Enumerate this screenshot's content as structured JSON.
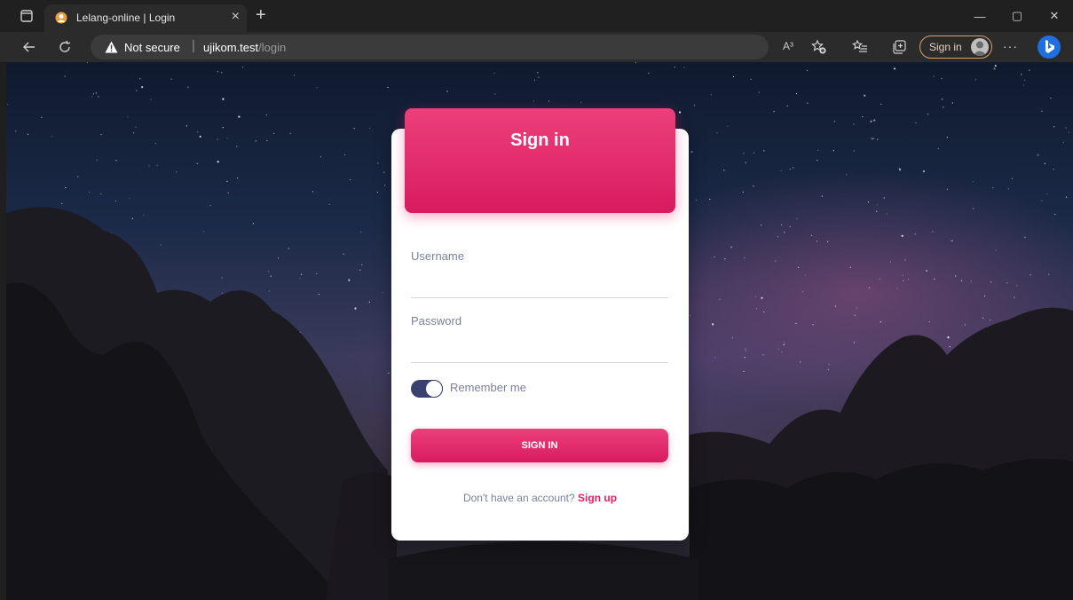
{
  "browser": {
    "tab_title": "Lelang-online | Login",
    "tab_close": "×",
    "new_tab": "+",
    "security_label": "Not secure",
    "address_separator": "|",
    "url_host": "ujikom.test",
    "url_path": "/login",
    "read_aloud": "A³",
    "profile_label": "Sign in",
    "more_menu": "···",
    "window_minimize": "—",
    "window_restore": "▢",
    "window_close": "✕"
  },
  "card": {
    "title": "Sign in",
    "username_label": "Username",
    "password_label": "Password",
    "remember_label": "Remember me",
    "remember_checked": true,
    "submit_label": "SIGN IN",
    "footer_text": "Don't have an account?",
    "signup_link": "Sign up"
  },
  "colors": {
    "accent": "#e91e63",
    "switch": "#3a416f",
    "muted_text": "#7b809a"
  }
}
